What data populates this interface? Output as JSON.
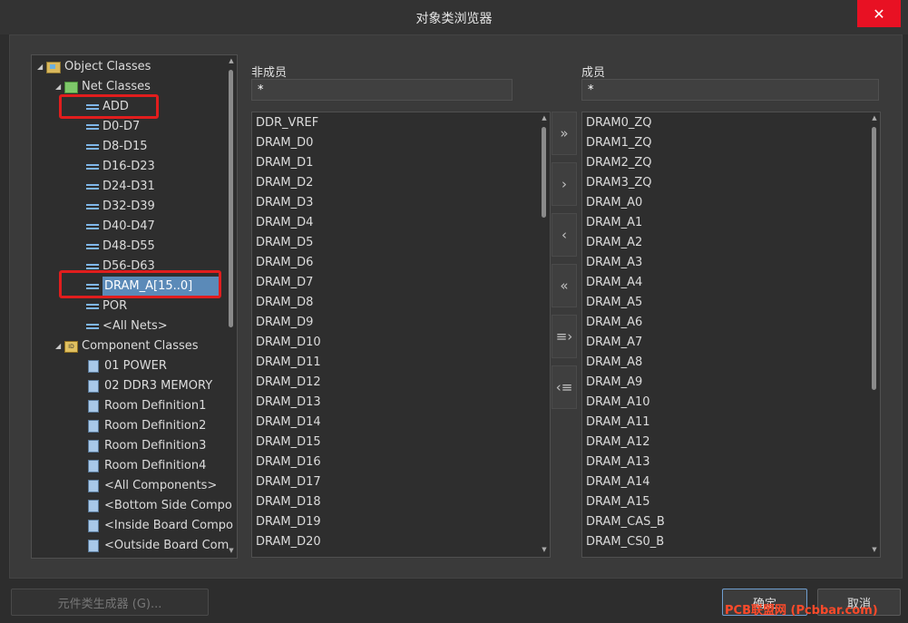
{
  "window": {
    "title": "对象类浏览器",
    "close_glyph": "✕"
  },
  "tree": {
    "root": "Object Classes",
    "net_classes": "Net Classes",
    "net_items": [
      "ADD",
      "D0-D7",
      "D8-D15",
      "D16-D23",
      "D24-D31",
      "D32-D39",
      "D40-D47",
      "D48-D55",
      "D56-D63",
      "DRAM_A[15..0]",
      "POR",
      "<All Nets>"
    ],
    "selected": "DRAM_A[15..0]",
    "component_classes": "Component Classes",
    "component_items": [
      "01 POWER",
      "02 DDR3 MEMORY",
      "Room Definition1",
      "Room Definition2",
      "Room Definition3",
      "Room Definition4",
      "<All Components>",
      "<Bottom Side Compo",
      "<Inside Board Compo",
      "<Outside Board Com"
    ]
  },
  "non_members": {
    "label": "非成员",
    "filter": "*",
    "items": [
      "DDR_VREF",
      "DRAM_D0",
      "DRAM_D1",
      "DRAM_D2",
      "DRAM_D3",
      "DRAM_D4",
      "DRAM_D5",
      "DRAM_D6",
      "DRAM_D7",
      "DRAM_D8",
      "DRAM_D9",
      "DRAM_D10",
      "DRAM_D11",
      "DRAM_D12",
      "DRAM_D13",
      "DRAM_D14",
      "DRAM_D15",
      "DRAM_D16",
      "DRAM_D17",
      "DRAM_D18",
      "DRAM_D19",
      "DRAM_D20"
    ]
  },
  "members": {
    "label": "成员",
    "filter": "*",
    "items": [
      "DRAM0_ZQ",
      "DRAM1_ZQ",
      "DRAM2_ZQ",
      "DRAM3_ZQ",
      "DRAM_A0",
      "DRAM_A1",
      "DRAM_A2",
      "DRAM_A3",
      "DRAM_A4",
      "DRAM_A5",
      "DRAM_A6",
      "DRAM_A7",
      "DRAM_A8",
      "DRAM_A9",
      "DRAM_A10",
      "DRAM_A11",
      "DRAM_A12",
      "DRAM_A13",
      "DRAM_A14",
      "DRAM_A15",
      "DRAM_CAS_B",
      "DRAM_CS0_B"
    ]
  },
  "transfer_buttons": [
    "»",
    "›",
    "‹",
    "«",
    "≡›",
    "‹≡"
  ],
  "buttons": {
    "generator": "元件类生成器 (G)...",
    "ok": "确定",
    "cancel": "取消"
  },
  "watermark": "PCB联盟网 (Pcbbar.com)",
  "colors": {
    "selection": "#5b8ab8",
    "highlight_box": "#e11d1d",
    "close": "#e81123"
  }
}
